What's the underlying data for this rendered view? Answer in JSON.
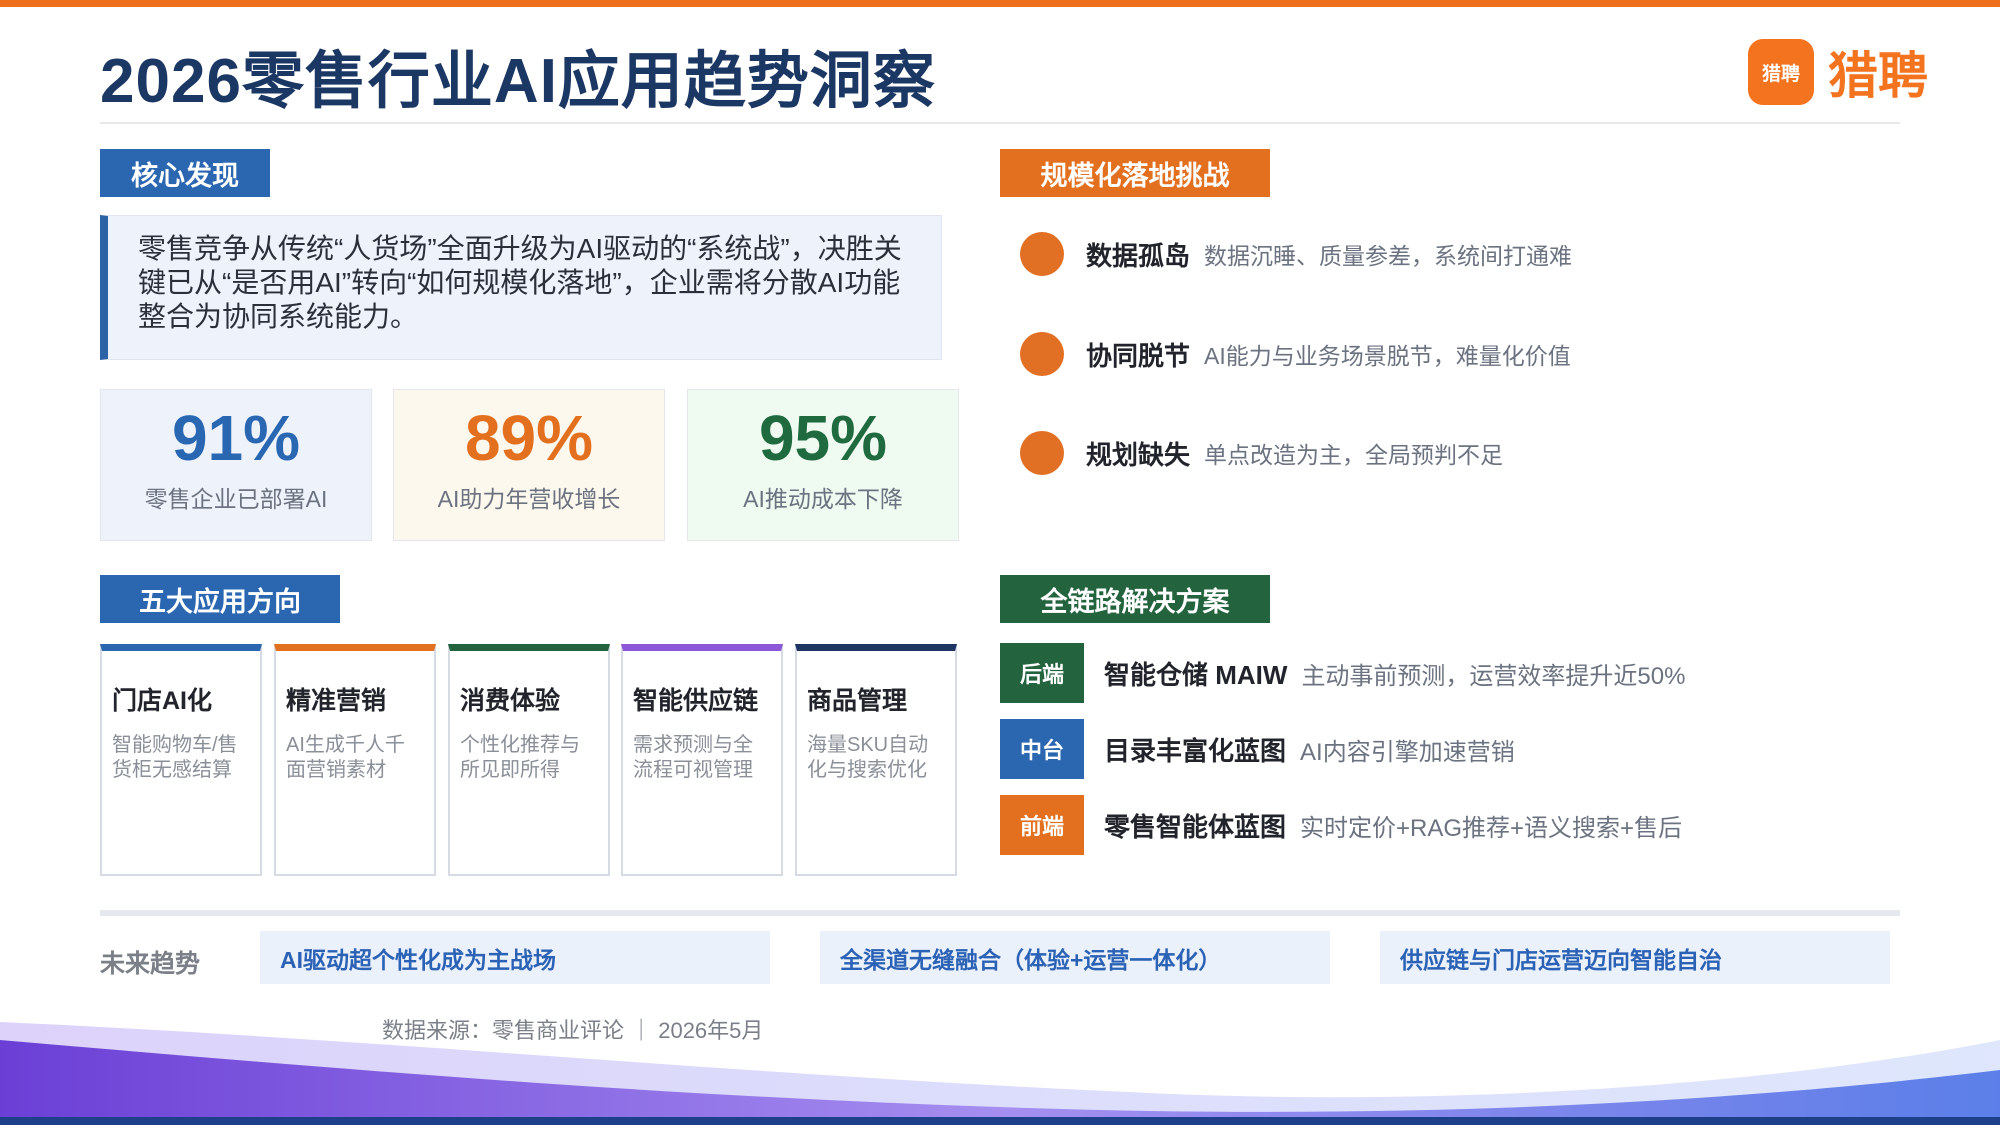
{
  "header": {
    "title": "2026零售行业AI应用趋势洞察",
    "logo_mark": "猎聘",
    "logo_text": "猎聘"
  },
  "sections": {
    "core": "核心发现",
    "directions": "五大应用方向",
    "challenges": "规模化落地挑战",
    "solutions": "全链路解决方案"
  },
  "callout": {
    "text": "零售竞争从传统“人货场”全面升级为AI驱动的“系统战”，决胜关键已从“是否用AI”转向“如何规模化落地”，企业需将分散AI功能整合为协同系统能力。"
  },
  "stats": [
    {
      "value": "91%",
      "label": "零售企业已部署AI",
      "color": "#2a67b3"
    },
    {
      "value": "89%",
      "label": "AI助力年营收增长",
      "color": "#e2701f"
    },
    {
      "value": "95%",
      "label": "AI推动成本下降",
      "color": "#1f6a3e"
    }
  ],
  "directions": [
    {
      "title": "门店AI化",
      "desc": "智能购物车/售货柜无感结算",
      "color": "#2b66b1"
    },
    {
      "title": "精准营销",
      "desc": "AI生成千人千面营销素材",
      "color": "#e2701f"
    },
    {
      "title": "消费体验",
      "desc": "个性化推荐与所见即所得",
      "color": "#23633e"
    },
    {
      "title": "智能供应链",
      "desc": "需求预测与全流程可视管理",
      "color": "#8c57d9"
    },
    {
      "title": "商品管理",
      "desc": "海量SKU自动化与搜索优化",
      "color": "#1e3561"
    }
  ],
  "challenges": [
    {
      "title": "数据孤岛",
      "desc": "数据沉睡、质量参差，系统间打通难"
    },
    {
      "title": "协同脱节",
      "desc": "AI能力与业务场景脱节，难量化价值"
    },
    {
      "title": "规划缺失",
      "desc": "单点改造为主，全局预判不足"
    }
  ],
  "solutions": [
    {
      "tag": "后端",
      "title": "智能仓储 MAIW",
      "desc": "主动事前预测，运营效率提升近50%",
      "color": "#23633e"
    },
    {
      "tag": "中台",
      "title": "目录丰富化蓝图",
      "desc": "AI内容引擎加速营销",
      "color": "#2b66b1"
    },
    {
      "tag": "前端",
      "title": "零售智能体蓝图",
      "desc": "实时定价+RAG推荐+语义搜索+售后",
      "color": "#e2701f"
    }
  ],
  "trends": {
    "label": "未来趋势",
    "items": [
      "AI驱动超个性化成为主战场",
      "全渠道无缝融合（体验+运营一体化）",
      "供应链与门店运营迈向智能自治"
    ]
  },
  "source": "数据来源：零售商业评论 ｜ 2026年5月",
  "colors": {
    "accent_orange": "#ee6f1c",
    "navy": "#1b3763",
    "blue": "#2b66b1",
    "green": "#23633e"
  }
}
